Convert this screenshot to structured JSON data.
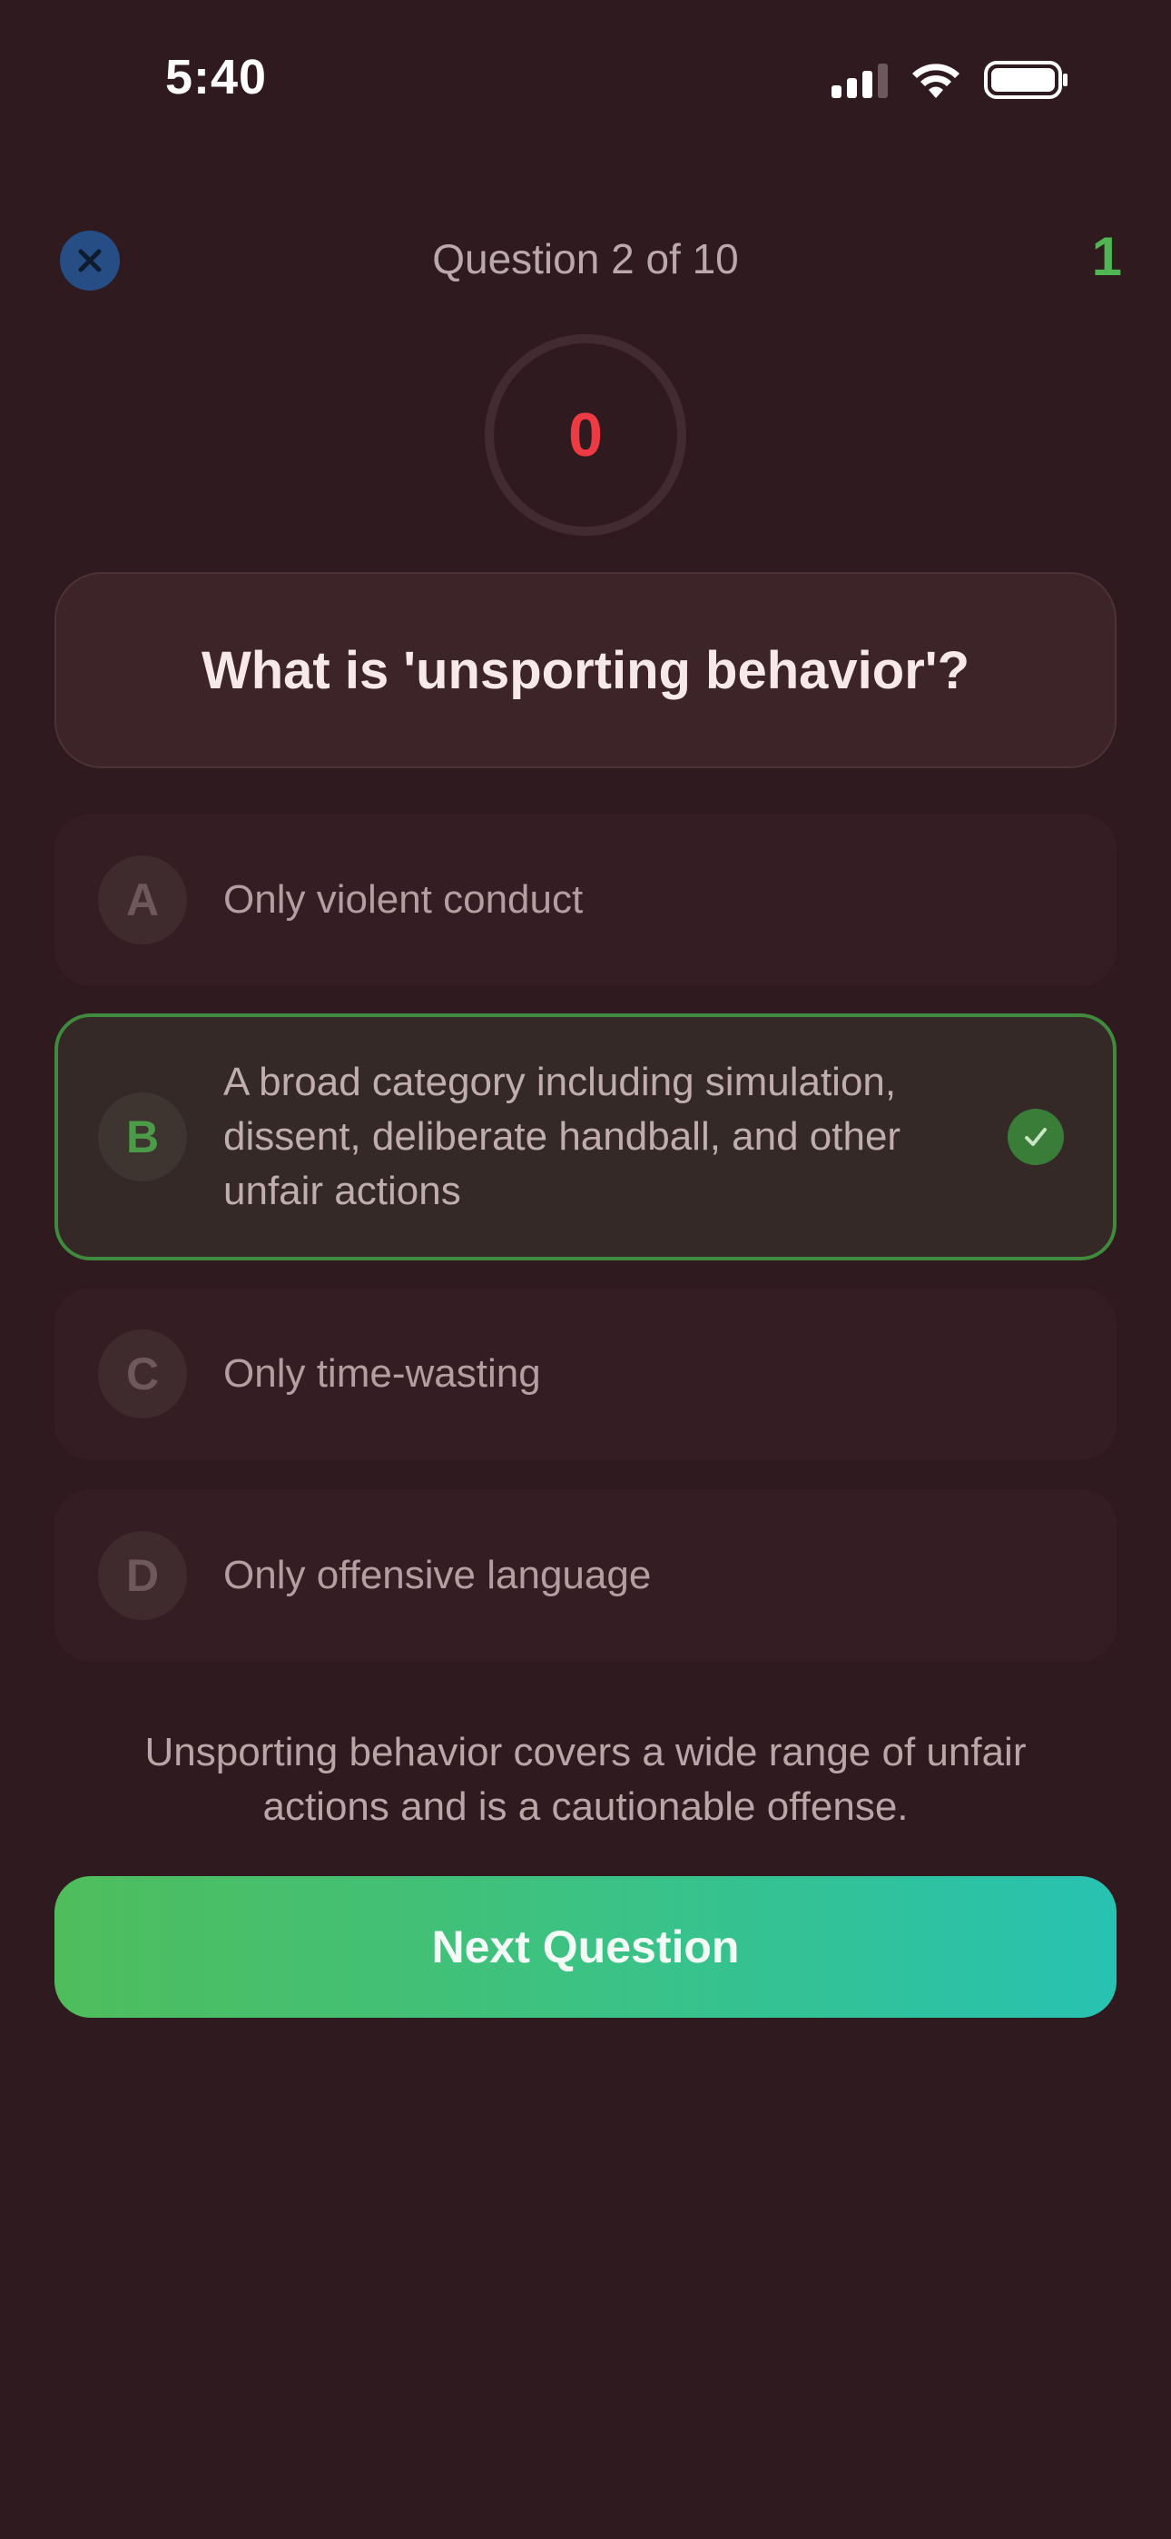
{
  "status_bar": {
    "time": "5:40"
  },
  "header": {
    "question_counter": "Question 2 of 10",
    "score": "1"
  },
  "timer": {
    "value": "0",
    "color": "#ee3b43"
  },
  "question": {
    "text": "What is 'unsporting behavior'?"
  },
  "options": [
    {
      "letter": "A",
      "text": "Only violent conduct",
      "state": "default"
    },
    {
      "letter": "B",
      "text": "A broad category including simulation, dissent, deliberate handball, and other unfair actions",
      "state": "correct"
    },
    {
      "letter": "C",
      "text": "Only time-wasting",
      "state": "default"
    },
    {
      "letter": "D",
      "text": "Only offensive language",
      "state": "default"
    }
  ],
  "explanation": "Unsporting behavior covers a wide range of unfair actions and is a cautionable offense.",
  "next_button": {
    "label": "Next Question"
  },
  "colors": {
    "background": "#2f1a20",
    "correct_green": "#3f8a3d",
    "close_button": "#264d84",
    "score_green": "#4fb653"
  },
  "icons": {
    "close": "close-icon",
    "check": "check-icon",
    "signal": "cellular-signal-icon",
    "wifi": "wifi-icon",
    "battery": "battery-icon"
  }
}
